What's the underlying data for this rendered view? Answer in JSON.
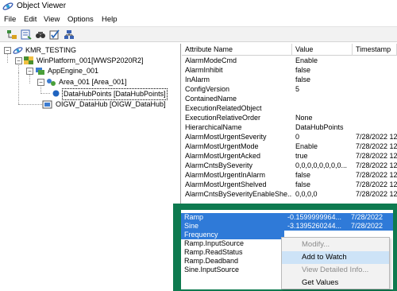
{
  "window": {
    "title": "Object Viewer"
  },
  "menu": [
    "File",
    "Edit",
    "View",
    "Options",
    "Help"
  ],
  "toolbar": {
    "buttons": [
      "tree-view-icon",
      "properties-icon",
      "find-icon",
      "edit-check-icon",
      "network-icon"
    ]
  },
  "tree": {
    "root": "KMR_TESTING",
    "platform": "WinPlatform_001[WWSP2020R2]",
    "engine": "AppEngine_001",
    "area": "Area_001 [Area_001]",
    "object": "DataHubPoints [DataHubPoints]",
    "hub": "OIGW_DataHub [OIGW_DataHub]"
  },
  "grid": {
    "columns": [
      "Attribute Name",
      "Value",
      "Timestamp"
    ],
    "rows": [
      {
        "name": "AlarmModeCmd",
        "value": "Enable",
        "ts": ""
      },
      {
        "name": "AlarmInhibit",
        "value": "false",
        "ts": ""
      },
      {
        "name": "InAlarm",
        "value": "false",
        "ts": ""
      },
      {
        "name": "ConfigVersion",
        "value": "5",
        "ts": ""
      },
      {
        "name": "ContainedName",
        "value": "",
        "ts": ""
      },
      {
        "name": "ExecutionRelatedObject",
        "value": "",
        "ts": ""
      },
      {
        "name": "ExecutionRelativeOrder",
        "value": "None",
        "ts": ""
      },
      {
        "name": "HierarchicalName",
        "value": "DataHubPoints",
        "ts": ""
      },
      {
        "name": "AlarmMostUrgentSeverity",
        "value": "0",
        "ts": "7/28/2022 12"
      },
      {
        "name": "AlarmMostUrgentMode",
        "value": "Enable",
        "ts": "7/28/2022 12"
      },
      {
        "name": "AlarmMostUrgentAcked",
        "value": "true",
        "ts": "7/28/2022 12"
      },
      {
        "name": "AlarmCntsBySeverity",
        "value": "0,0,0,0,0,0,0,0...",
        "ts": "7/28/2022 12"
      },
      {
        "name": "AlarmMostUrgentInAlarm",
        "value": "false",
        "ts": "7/28/2022 12"
      },
      {
        "name": "AlarmMostUrgentShelved",
        "value": "false",
        "ts": "7/28/2022 12"
      },
      {
        "name": "AlarmCntsBySeverityEnableShe...",
        "value": "0,0,0,0",
        "ts": "7/28/2022 12"
      }
    ]
  },
  "watch": {
    "rows": [
      {
        "name": "Ramp",
        "value": "-0.1599999964...",
        "ts": "7/28/2022"
      },
      {
        "name": "Sine",
        "value": "-3.1395260244...",
        "ts": "7/28/2022"
      },
      {
        "name": "Frequency",
        "value": "",
        "ts": ""
      },
      {
        "name": "Ramp.InputSource",
        "value": "",
        "ts": ""
      },
      {
        "name": "Ramp.ReadStatus",
        "value": "",
        "ts": ""
      },
      {
        "name": "Ramp.Deadband",
        "value": "",
        "ts": ""
      },
      {
        "name": "Sine.InputSource",
        "value": "",
        "ts": ""
      }
    ]
  },
  "context_menu": {
    "items": [
      {
        "label": "Modify...",
        "disabled": true
      },
      {
        "label": "Add to Watch",
        "disabled": false
      },
      {
        "label": "View Detailed Info...",
        "disabled": true
      },
      {
        "label": "Get Values",
        "disabled": false
      }
    ]
  },
  "colors": {
    "highlight": "#2f7ad8",
    "watch_border": "#0e7a4f",
    "menu_hover": "#cde3f7"
  }
}
